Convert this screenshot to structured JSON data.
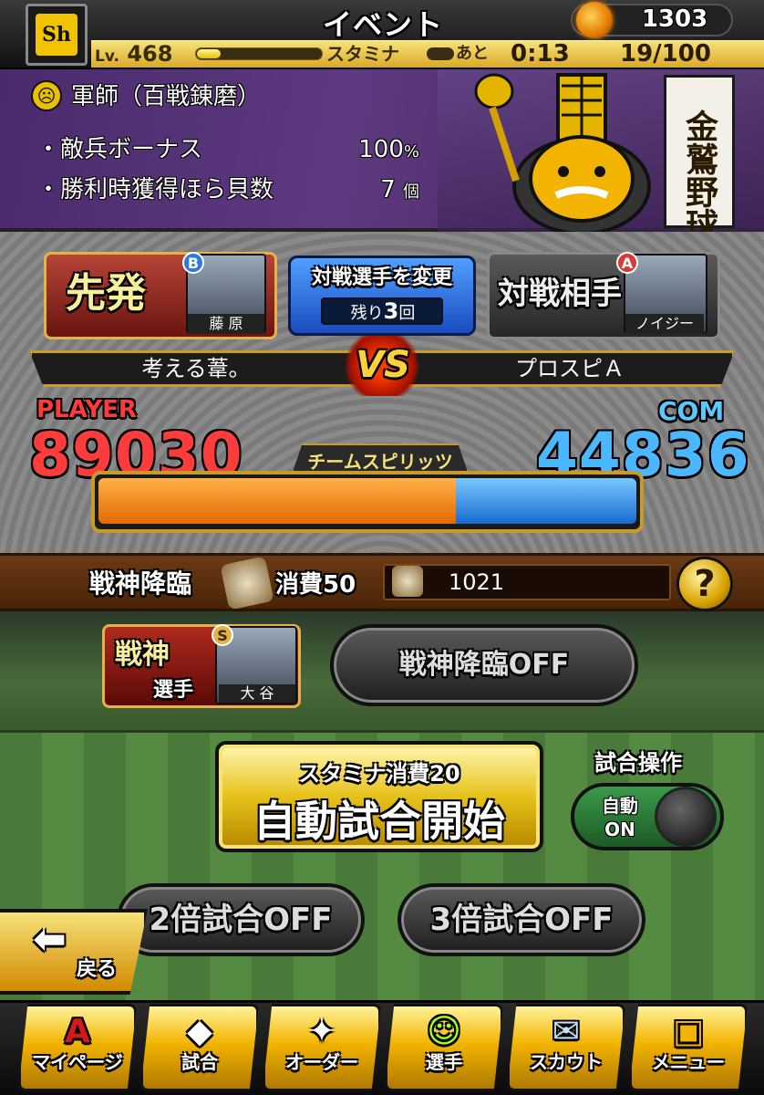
{
  "header": {
    "title": "イベント",
    "team_logo": "Sh",
    "coins": "1303",
    "level_prefix": "Lv.",
    "level": "468",
    "stamina_label": "スタミナ",
    "timer_label": "あと",
    "timer": "0:13",
    "stamina": "19/100",
    "stamina_fraction": 0.19
  },
  "strategist": {
    "name": "軍師（百戦錬磨）",
    "bonuses": [
      {
        "label": "・敵兵ボーナス",
        "value": "100",
        "unit": "%"
      },
      {
        "label": "・勝利時獲得ほら貝数",
        "value": "7",
        "unit": "個"
      }
    ],
    "banner_text": "金鷲野球"
  },
  "versus": {
    "starter_label": "先発",
    "starter_rank": "B",
    "starter_name": "藤 原",
    "change_label": "対戦選手を変更",
    "remaining_prefix": "残り",
    "remaining_count": "3",
    "remaining_suffix": "回",
    "opponent_label": "対戦相手",
    "opponent_rank": "A",
    "opponent_name": "ノイジー",
    "player_team": "考える葦。",
    "com_team": "プロスピＡ",
    "vs": "VS",
    "player_tag": "PLAYER",
    "com_tag": "COM",
    "player_score": "89030",
    "com_score": "44836",
    "spirit_label": "チームスピリッツ"
  },
  "wargod": {
    "title": "戦神降臨",
    "cost_label": "消費50",
    "owned": "1021",
    "help": "?",
    "player_label": "戦神",
    "player_sub": "選手",
    "player_rank": "S",
    "player_name": "大 谷",
    "toggle_label": "戦神降臨OFF"
  },
  "controls": {
    "auto_cost": "スタミナ消費20",
    "auto_label": "自動試合開始",
    "op_title": "試合操作",
    "op_toggle_line1": "自動",
    "op_toggle_line2": "ON",
    "x2_label": "2倍試合OFF",
    "x3_label": "3倍試合OFF",
    "back_label": "戻る"
  },
  "nav": [
    {
      "label": "マイページ",
      "icon": "A"
    },
    {
      "label": "試合",
      "icon": "◆"
    },
    {
      "label": "オーダー",
      "icon": "✦"
    },
    {
      "label": "選手",
      "icon": "☺"
    },
    {
      "label": "スカウト",
      "icon": "✉"
    },
    {
      "label": "メニュー",
      "icon": "▣"
    }
  ],
  "colors": {
    "player": "#ff3c3c",
    "com": "#4ab7ff",
    "gold": "#f2b400"
  }
}
